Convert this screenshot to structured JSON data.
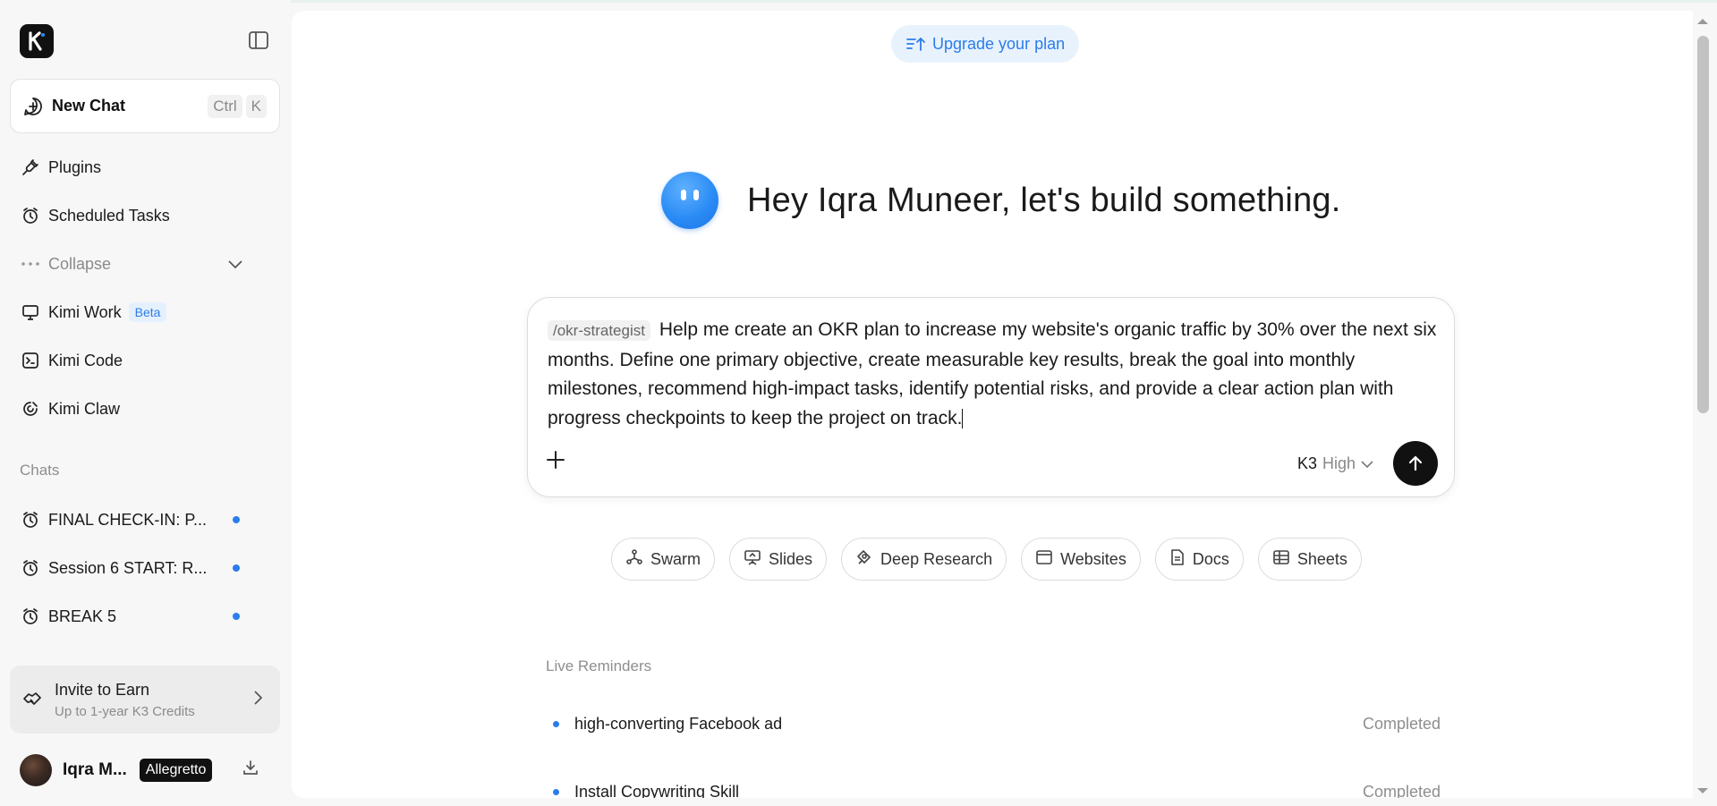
{
  "sidebar": {
    "new_chat": {
      "label": "New Chat",
      "shortcut_keys": [
        "Ctrl",
        "K"
      ]
    },
    "nav": [
      {
        "label": "Plugins",
        "icon": "plug-icon"
      },
      {
        "label": "Scheduled Tasks",
        "icon": "alarm-clock-icon"
      },
      {
        "label": "Collapse",
        "icon": "more-dots-icon"
      },
      {
        "label": "Kimi Work",
        "icon": "monitor-icon",
        "badge": "Beta"
      },
      {
        "label": "Kimi Code",
        "icon": "terminal-icon"
      },
      {
        "label": "Kimi Claw",
        "icon": "claw-icon"
      }
    ],
    "chats_label": "Chats",
    "chats": [
      {
        "label": "FINAL CHECK-IN: P..."
      },
      {
        "label": "Session 6 START: R..."
      },
      {
        "label": "BREAK 5"
      }
    ],
    "invite": {
      "title": "Invite to Earn",
      "subtitle": "Up to 1-year K3 Credits"
    },
    "user": {
      "name": "Iqra M...",
      "plan": "Allegretto"
    }
  },
  "main": {
    "upgrade_label": "Upgrade your plan",
    "greeting": "Hey Iqra Muneer, let's build something.",
    "composer": {
      "skill_chip": "/okr-strategist",
      "text": "Help me create an OKR plan to increase my website's organic traffic by 30% over the next six months. Define one primary objective, create measurable key results, break the goal into monthly milestones, recommend high-impact tasks, identify potential risks, and provide a clear action plan with progress checkpoints to keep the project on track.",
      "model": "K3",
      "level": "High"
    },
    "tools": [
      {
        "label": "Swarm",
        "icon": "swarm-icon"
      },
      {
        "label": "Slides",
        "icon": "presentation-icon"
      },
      {
        "label": "Deep Research",
        "icon": "research-icon"
      },
      {
        "label": "Websites",
        "icon": "browser-window-icon"
      },
      {
        "label": "Docs",
        "icon": "document-icon"
      },
      {
        "label": "Sheets",
        "icon": "table-icon"
      }
    ],
    "reminders_title": "Live Reminders",
    "reminders": [
      {
        "title": "high-converting Facebook ad",
        "status": "Completed"
      },
      {
        "title": "Install Copywriting Skill",
        "status": "Completed"
      }
    ]
  },
  "colors": {
    "accent": "#2b7de9",
    "sidebar_bg": "#f7f7f7",
    "send_button": "#111111"
  }
}
